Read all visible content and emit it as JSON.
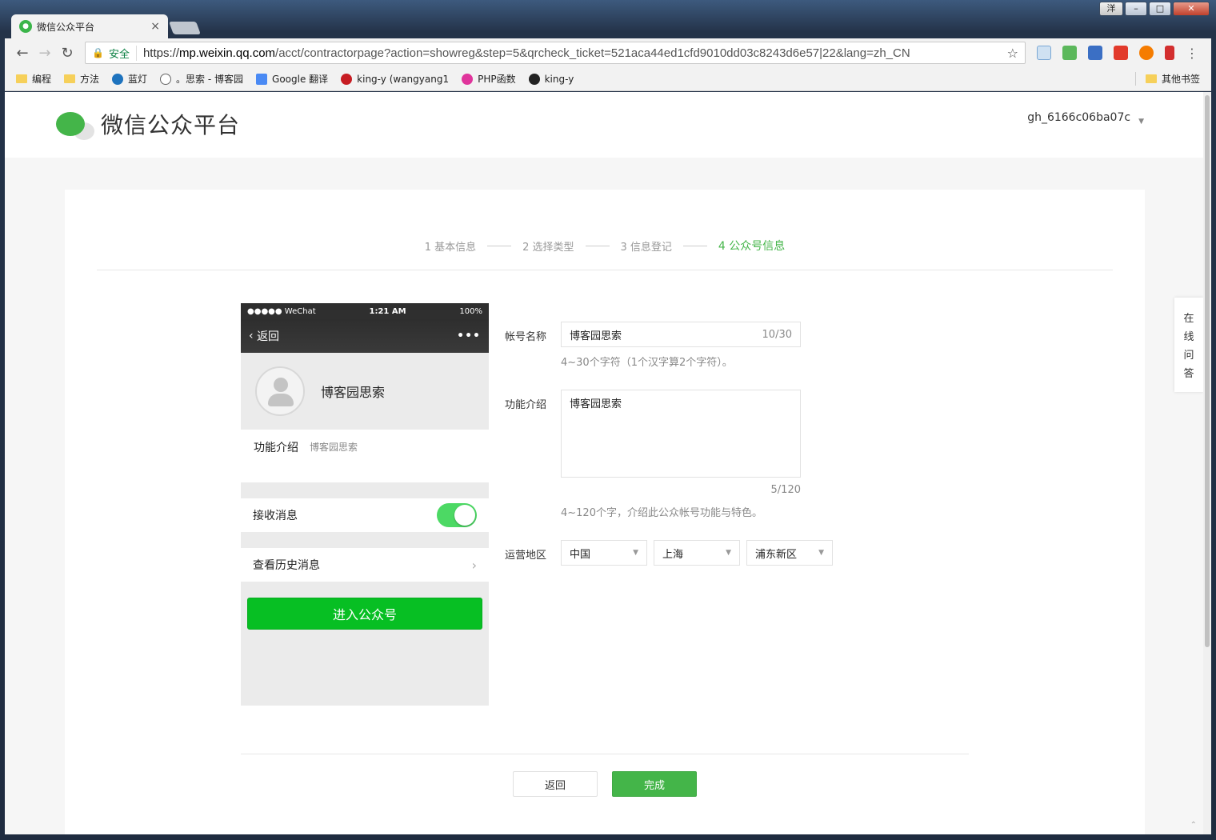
{
  "window": {
    "user_badge": "洋",
    "min": "–",
    "max": "□",
    "close": "✕"
  },
  "tab": {
    "title": "微信公众平台",
    "close": "×"
  },
  "toolbar": {
    "back": "←",
    "forward": "→",
    "reload": "↻",
    "secure_label": "安全",
    "url_scheme": "https://",
    "url_host": "mp.weixin.qq.com",
    "url_path": "/acct/contractorpage?action=showreg&step=5&qrcheck_ticket=521aca44ed1cfd9010dd03c8243d6e57|22&lang=zh_CN",
    "star": "☆",
    "menu": "⋮"
  },
  "bookmarks": [
    {
      "label": "编程",
      "icon": "folder-icon"
    },
    {
      "label": "方法",
      "icon": "folder-icon"
    },
    {
      "label": "蓝灯",
      "icon": "lantern-icon"
    },
    {
      "label": "。思索 - 博客园",
      "icon": "cnblogs-icon"
    },
    {
      "label": "Google 翻译",
      "icon": "translate-icon"
    },
    {
      "label": "king-y (wangyang1",
      "icon": "gitee-icon"
    },
    {
      "label": "PHP函数",
      "icon": "php-icon"
    },
    {
      "label": "king-y",
      "icon": "github-icon"
    }
  ],
  "bookmarks_other": "其他书签",
  "header": {
    "brand": "微信公众平台",
    "account": "gh_6166c06ba07c"
  },
  "steps": [
    {
      "label": "1 基本信息"
    },
    {
      "label": "2 选择类型"
    },
    {
      "label": "3 信息登记"
    },
    {
      "label": "4 公众号信息"
    }
  ],
  "phone": {
    "carrier": "●●●●● WeChat",
    "time": "1:21 AM",
    "battery": "100%",
    "back": "返回",
    "more": "•••",
    "name": "博客园思索",
    "intro_label": "功能介绍",
    "intro_value": "博客园思索",
    "receive": "接收消息",
    "history": "查看历史消息",
    "chevron": "›",
    "enter": "进入公众号"
  },
  "form": {
    "name_label": "帐号名称",
    "name_value": "博客园思索",
    "name_count": "10/30",
    "name_hint": "4~30个字符（1个汉字算2个字符）。",
    "intro_label": "功能介绍",
    "intro_value": "博客园思索",
    "intro_count": "5/120",
    "intro_hint": "4~120个字，介绍此公众帐号功能与特色。",
    "region_label": "运营地区",
    "country": "中国",
    "province": "上海",
    "district": "浦东新区"
  },
  "buttons": {
    "back": "返回",
    "done": "完成"
  },
  "help": [
    "在",
    "线",
    "问",
    "答"
  ],
  "colors": {
    "brand_green": "#44b549",
    "toggle_green": "#4cd964",
    "enter_green": "#07bf23"
  }
}
